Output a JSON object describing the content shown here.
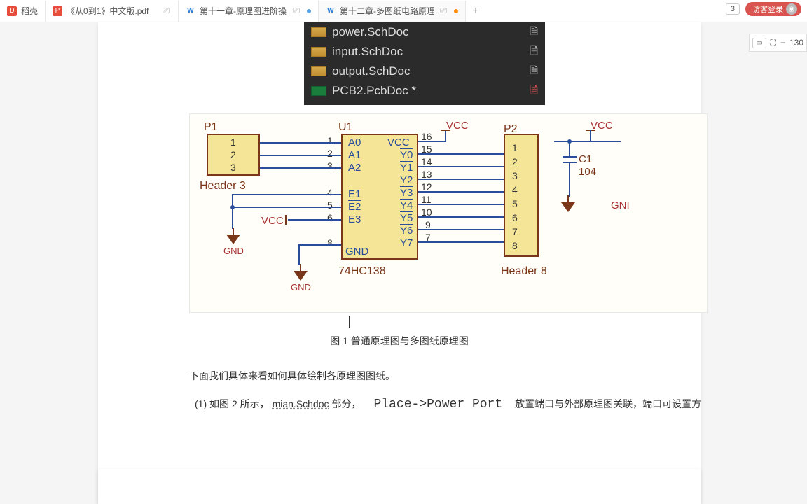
{
  "tabs": {
    "t0_label": "稻壳",
    "t1_label": "《从0到1》中文版.pdf",
    "t2_label": "第十一章-原理图进阶操作.doc",
    "t3_label": "第十二章-多图纸电路原理图设计"
  },
  "top": {
    "counter": "3",
    "login": "访客登录"
  },
  "files": {
    "f0": "power.SchDoc",
    "f1": "input.SchDoc",
    "f2": "output.SchDoc",
    "f3": "PCB2.PcbDoc *"
  },
  "schematic": {
    "p1": "P1",
    "u1": "U1",
    "p2": "P2",
    "vcc": "VCC",
    "gnd": "GND",
    "header3": "Header 3",
    "header8": "Header 8",
    "chip_name": "74HC138",
    "c1": "C1",
    "c1_val": "104",
    "a0": "A0",
    "a1": "A1",
    "a2": "A2",
    "e1": "E1",
    "e2": "E2",
    "e3": "E3",
    "chip_vcc": "VCC",
    "chip_gnd": "GND",
    "y0": "Y0",
    "y1": "Y1",
    "y2": "Y2",
    "y3": "Y3",
    "y4": "Y4",
    "y5": "Y5",
    "y6": "Y6",
    "y7": "Y7"
  },
  "caption": "图 1 普通原理图与多图纸原理图",
  "body": {
    "line1": "下面我们具体来看如何具体绘制各原理图图纸。",
    "line2_a": "(1) 如图 2 所示，",
    "line2_link": "mian.Schdoc ",
    "line2_b": "部分，",
    "line2_mono": "Place->Power Port",
    "line2_c": "放置端口与外部原理图关联，端口可设置方"
  },
  "zoom": {
    "value": "130"
  }
}
